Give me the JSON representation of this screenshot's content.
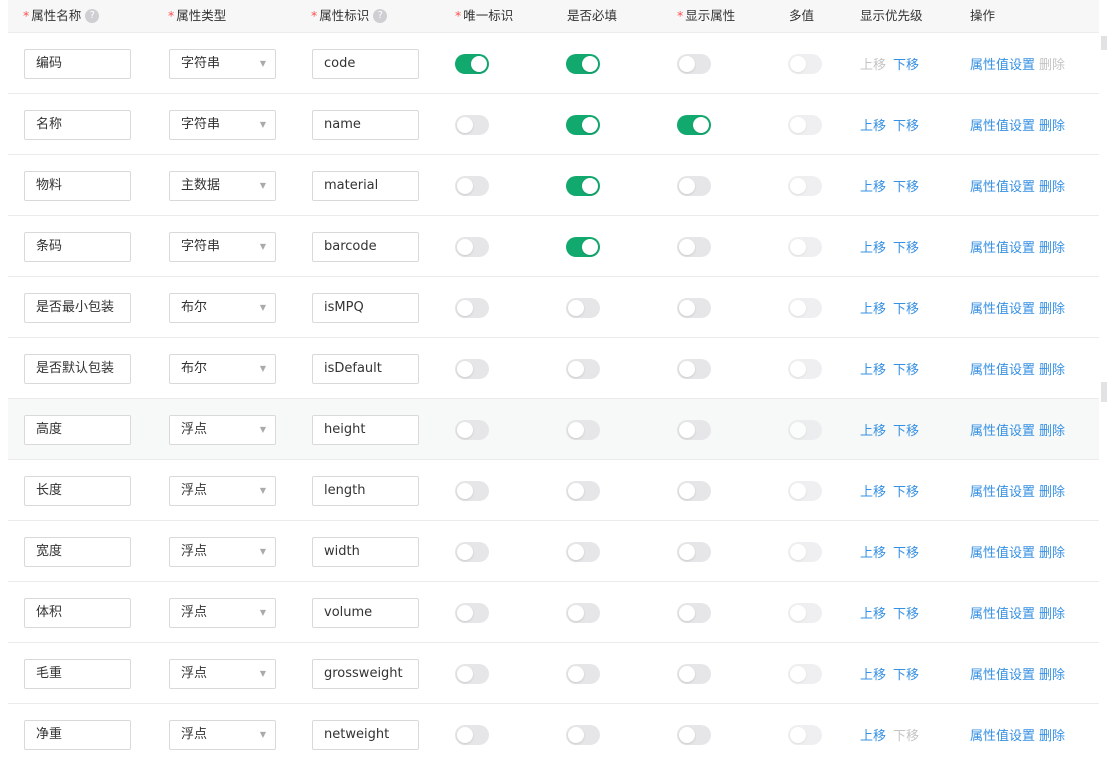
{
  "header": {
    "name": "属性名称",
    "type": "属性类型",
    "key": "属性标识",
    "unique": "唯一标识",
    "required": "是否必填",
    "display": "显示属性",
    "multi": "多值",
    "priority": "显示优先级",
    "actions": "操作",
    "required_mark": "*",
    "help_glyph": "?"
  },
  "actions": {
    "up": "上移",
    "down": "下移",
    "settings": "属性值设置",
    "delete": "删除"
  },
  "select_arrow": "▼",
  "colors": {
    "switch_on": "#12a96f",
    "link": "#3690e3",
    "disabled_link": "#c4c4c4"
  },
  "rows": [
    {
      "name": "编码",
      "type": "字符串",
      "key": "code",
      "unique": true,
      "required": true,
      "display": false,
      "multi": false,
      "up_enabled": false,
      "down_enabled": true,
      "delete_enabled": false
    },
    {
      "name": "名称",
      "type": "字符串",
      "key": "name",
      "unique": false,
      "required": true,
      "display": true,
      "multi": false,
      "up_enabled": true,
      "down_enabled": true,
      "delete_enabled": true
    },
    {
      "name": "物料",
      "type": "主数据",
      "key": "material",
      "unique": false,
      "required": true,
      "display": false,
      "multi": false,
      "up_enabled": true,
      "down_enabled": true,
      "delete_enabled": true
    },
    {
      "name": "条码",
      "type": "字符串",
      "key": "barcode",
      "unique": false,
      "required": true,
      "display": false,
      "multi": false,
      "up_enabled": true,
      "down_enabled": true,
      "delete_enabled": true
    },
    {
      "name": "是否最小包装",
      "type": "布尔",
      "key": "isMPQ",
      "unique": false,
      "required": false,
      "display": false,
      "multi": false,
      "up_enabled": true,
      "down_enabled": true,
      "delete_enabled": true
    },
    {
      "name": "是否默认包装",
      "type": "布尔",
      "key": "isDefault",
      "unique": false,
      "required": false,
      "display": false,
      "multi": false,
      "up_enabled": true,
      "down_enabled": true,
      "delete_enabled": true
    },
    {
      "name": "高度",
      "type": "浮点",
      "key": "height",
      "unique": false,
      "required": false,
      "display": false,
      "multi": false,
      "up_enabled": true,
      "down_enabled": true,
      "delete_enabled": true
    },
    {
      "name": "长度",
      "type": "浮点",
      "key": "length",
      "unique": false,
      "required": false,
      "display": false,
      "multi": false,
      "up_enabled": true,
      "down_enabled": true,
      "delete_enabled": true
    },
    {
      "name": "宽度",
      "type": "浮点",
      "key": "width",
      "unique": false,
      "required": false,
      "display": false,
      "multi": false,
      "up_enabled": true,
      "down_enabled": true,
      "delete_enabled": true
    },
    {
      "name": "体积",
      "type": "浮点",
      "key": "volume",
      "unique": false,
      "required": false,
      "display": false,
      "multi": false,
      "up_enabled": true,
      "down_enabled": true,
      "delete_enabled": true
    },
    {
      "name": "毛重",
      "type": "浮点",
      "key": "grossweight",
      "unique": false,
      "required": false,
      "display": false,
      "multi": false,
      "up_enabled": true,
      "down_enabled": true,
      "delete_enabled": true
    },
    {
      "name": "净重",
      "type": "浮点",
      "key": "netweight",
      "unique": false,
      "required": false,
      "display": false,
      "multi": false,
      "up_enabled": true,
      "down_enabled": false,
      "delete_enabled": true
    }
  ]
}
